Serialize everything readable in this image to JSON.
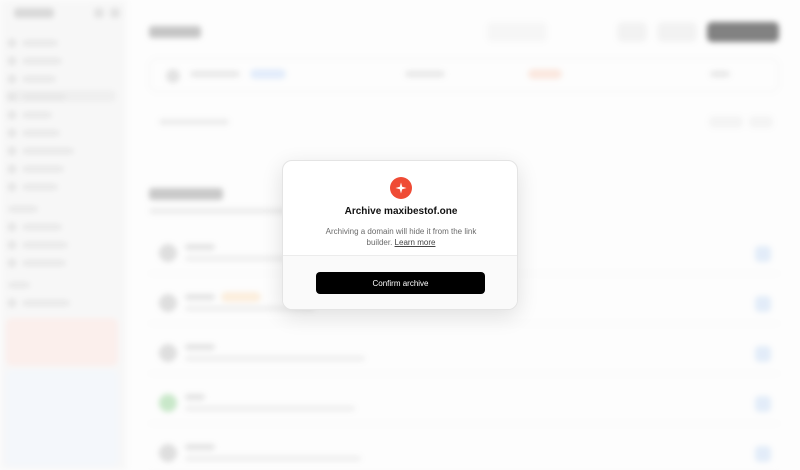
{
  "modal": {
    "title": "Archive maxibestof.one",
    "description": "Archiving a domain will hide it from the link builder.",
    "learn_more": "Learn more",
    "confirm_label": "Confirm archive",
    "icon": "sparkle-icon",
    "accent_color": "#ef4b35"
  }
}
